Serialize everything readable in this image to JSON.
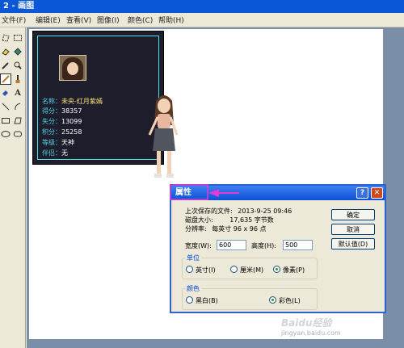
{
  "window": {
    "title": "2 - 画图"
  },
  "menu": [
    {
      "label": "文件(F)"
    },
    {
      "label": "编辑(E)"
    },
    {
      "label": "查看(V)"
    },
    {
      "label": "图像(I)"
    },
    {
      "label": "颜色(C)"
    },
    {
      "label": "帮助(H)"
    }
  ],
  "tools": [
    "free-select",
    "rect-select",
    "eraser",
    "fill",
    "eyedropper",
    "magnifier",
    "pencil",
    "brush",
    "airbrush",
    "text",
    "line",
    "curve",
    "rectangle",
    "polygon",
    "ellipse",
    "rounded-rect"
  ],
  "profile": {
    "stats": [
      {
        "key": "名称：",
        "value": "未央-红月紫嫣"
      },
      {
        "key": "得分：",
        "value": "38357"
      },
      {
        "key": "失分：",
        "value": "13099"
      },
      {
        "key": "积分：",
        "value": "25258"
      },
      {
        "key": "等级：",
        "value": "天神"
      },
      {
        "key": "伴侣：",
        "value": "无"
      }
    ]
  },
  "dialog": {
    "title": "属性",
    "help_label": "?",
    "close_label": "✕",
    "info": {
      "saved_label": "上次保存的文件:",
      "saved_value": "2013-9-25  09:46",
      "size_label": "磁盘大小:",
      "size_value": "17,635 字节数",
      "resolution_label": "分辨率:",
      "resolution_value": "每英寸 96 x 96 点"
    },
    "width_label": "宽度(W):",
    "width_value": "600",
    "height_label": "高度(H):",
    "height_value": "500",
    "buttons": {
      "ok": "确定",
      "cancel": "取消",
      "default": "默认值(D)"
    },
    "units": {
      "label": "单位",
      "inches": "英寸(I)",
      "cm": "厘米(M)",
      "pixels": "像素(P)",
      "selected": "pixels"
    },
    "colors": {
      "label": "颜色",
      "bw": "黑白(B)",
      "color": "彩色(L)",
      "selected": "color"
    }
  },
  "watermark": {
    "main": "Baidu经验",
    "sub": "jingyan.baidu.com"
  },
  "accent": {
    "titlebar": "#0a58d8",
    "dialog_border": "#2e62d3",
    "annotation_arrow": "#e23bd4",
    "poster_frame": "#4ce0e8"
  }
}
